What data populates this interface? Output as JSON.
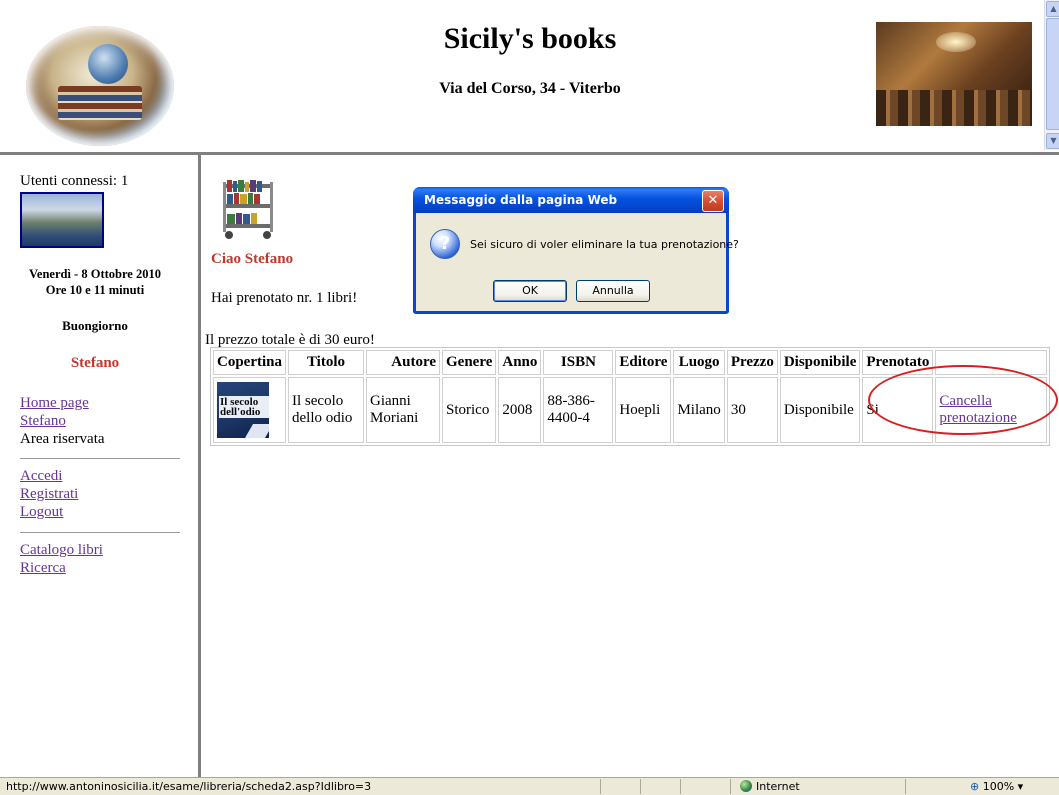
{
  "header": {
    "title": "Sicily's books",
    "address": "Via del Corso, 34 - Viterbo"
  },
  "sidebar": {
    "connected_users": "Utenti connessi: 1",
    "date": "Venerdì - 8 Ottobre 2010",
    "time": "Ore 10 e 11 minuti",
    "greeting": "Buongiorno",
    "user": "Stefano",
    "links_group1": [
      "Home page",
      "Stefano"
    ],
    "reserved_area": "Area riservata",
    "links_group2": [
      "Accedi",
      "Registrati",
      "Logout"
    ],
    "links_group3": [
      "Catalogo libri",
      "Ricerca"
    ]
  },
  "main": {
    "hello": "Ciao Stefano",
    "booked_count": "Hai prenotato nr. 1 libri!",
    "total_price": "Il prezzo totale è di 30 euro!",
    "table": {
      "headers": [
        "Copertina",
        "Titolo",
        "Autore",
        "Genere",
        "Anno",
        "ISBN",
        "Editore",
        "Luogo",
        "Prezzo",
        "Disponibile",
        "Prenotato",
        ""
      ],
      "rows": [
        {
          "cover_text": "Il secolo dell'odio",
          "titolo": "Il secolo dello odio",
          "autore": "Gianni Moriani",
          "genere": "Storico",
          "anno": "2008",
          "isbn": "88-386-4400-4",
          "editore": "Hoepli",
          "luogo": "Milano",
          "prezzo": "30",
          "disponibile": "Disponibile",
          "prenotato": "Si",
          "action": "Cancella prenotazione"
        }
      ]
    }
  },
  "dialog": {
    "title": "Messaggio dalla pagina Web",
    "message": "Sei sicuro di voler eliminare la tua prenotazione?",
    "ok_label": "OK",
    "cancel_label": "Annulla",
    "close_glyph": "✕",
    "icon": "question-icon"
  },
  "statusbar": {
    "url": "http://www.antoninosicilia.it/esame/libreria/scheda2.asp?Idlibro=3",
    "zone": "Internet",
    "zoom": "100%"
  },
  "colors": {
    "accent_red": "#c0392b",
    "visited_link": "#663399",
    "dialog_title_blue": "#0452dd",
    "highlight_ellipse": "#d62020"
  }
}
